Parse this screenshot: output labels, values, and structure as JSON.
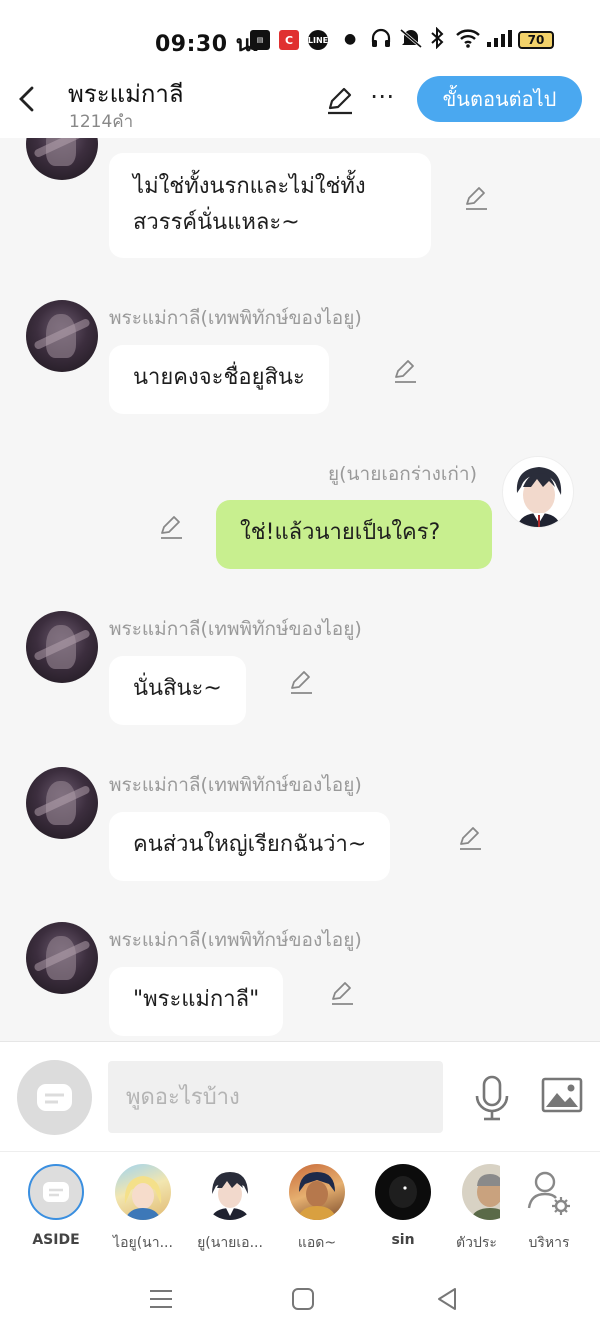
{
  "status": {
    "time": "09:30 น.",
    "battery": "70",
    "icons": [
      "shopee-icon",
      "c-app-icon",
      "line-icon",
      "dot-icon",
      "headphone-icon",
      "mute-icon",
      "bluetooth-icon",
      "wifi-icon",
      "signal-icon"
    ]
  },
  "header": {
    "title": "พระแม่กาลี",
    "word_count": "1214คำ",
    "next_label": "ขั้นตอนต่อไป"
  },
  "messages": [
    {
      "sender": "",
      "text_lines": [
        "ไม่ใช่ทั้งนรกและไม่ใช่ทั้ง",
        "สวรรค์นั่นแหละ~"
      ],
      "from_me": false
    },
    {
      "sender": "พระแม่กาลี(เทพพิทักษ์ของไอยู)",
      "text": "นายคงจะชื่อยูสินะ",
      "from_me": false
    },
    {
      "sender": "ยู(นายเอกร่างเก่า)",
      "text": "ใช่!แล้วนายเป็นใคร?",
      "from_me": true
    },
    {
      "sender": "พระแม่กาลี(เทพพิทักษ์ของไอยู)",
      "text": "นั่นสินะ~",
      "from_me": false
    },
    {
      "sender": "พระแม่กาลี(เทพพิทักษ์ของไอยู)",
      "text": "คนส่วนใหญ่เรียกฉันว่า~",
      "from_me": false
    },
    {
      "sender": "พระแม่กาลี(เทพพิทักษ์ของไอยู)",
      "text": "\"พระแม่กาลี\"",
      "from_me": false
    }
  ],
  "input": {
    "placeholder": "พูดอะไรบ้าง"
  },
  "characters": [
    {
      "label": "ASIDE",
      "active": true
    },
    {
      "label": "ไอยู(นา..."
    },
    {
      "label": "ยู(นายเอ..."
    },
    {
      "label": "แอด~"
    },
    {
      "label": "sin"
    },
    {
      "label": "ตัวประ"
    },
    {
      "label": "บริหาร"
    }
  ],
  "colors": {
    "accent": "#4aa8f0",
    "my_bubble": "#c8ef8f",
    "chat_bg": "#f6f6f6"
  }
}
